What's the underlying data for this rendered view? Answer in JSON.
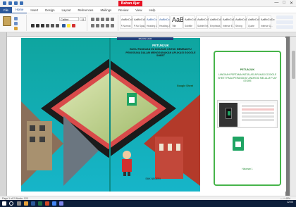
{
  "window": {
    "title_box": "Bahan Ajar",
    "controls": [
      "—",
      "□",
      "✕"
    ]
  },
  "menu": {
    "tabs": [
      "File",
      "Home",
      "Insert",
      "Design",
      "Layout",
      "References",
      "Mailings",
      "Review",
      "View",
      "Help"
    ]
  },
  "ribbon": {
    "font_name": "Calibri",
    "font_size": "11",
    "styles": [
      {
        "sample": "AaBbCcDc",
        "label": "¶ Normal"
      },
      {
        "sample": "AaBbCcDc",
        "label": "¶ No Spac..."
      },
      {
        "sample": "AaBbCc",
        "label": "Heading 1"
      },
      {
        "sample": "AaBbCc",
        "label": "Heading 2"
      },
      {
        "sample": "AaB",
        "label": "Title"
      },
      {
        "sample": "AaBbCcD",
        "label": "Subtitle"
      },
      {
        "sample": "AaBbCcDc",
        "label": "Subtle Em..."
      },
      {
        "sample": "AaBbCcDc",
        "label": "Emphasis"
      },
      {
        "sample": "AaBbCcDc",
        "label": "Intense E..."
      },
      {
        "sample": "AaBbCcDc",
        "label": "Strong"
      },
      {
        "sample": "AaBbCcDc",
        "label": "Quote"
      },
      {
        "sample": "AaBbCcDc",
        "label": "Intense Q..."
      }
    ]
  },
  "cover": {
    "spine_label": "BAHAN AJAR",
    "back_title": "PETUNJUK",
    "back_text": "BUKU PANDUAN INI DISUSUN UNTUK MEMBANTU PENGGUNA DALAM MENGGUNAKAN APLIKASI GOOGLE SHEET",
    "subtitle": "Google Sheet",
    "mascot_label": "SMK NEGERI"
  },
  "right_page": {
    "title": "PETUNJUK",
    "body": "LANGKAH PERTAMA INSTALASI APLIKASI GOOGLE SHEET PADA PERANGKAT ANDROID MELALUI PLAY STORE",
    "footer": "Halaman 1"
  },
  "status": {
    "left": "Page 1 of 2   Words: 120",
    "zoom": "— + 45%"
  },
  "taskbar": {
    "time": "12:00",
    "date": "01/01/2021"
  },
  "colors": {
    "accent": "#2b579a",
    "cover_teal": "#12a6a4",
    "frame_green": "#46b44a",
    "title_red": "#e81123"
  }
}
